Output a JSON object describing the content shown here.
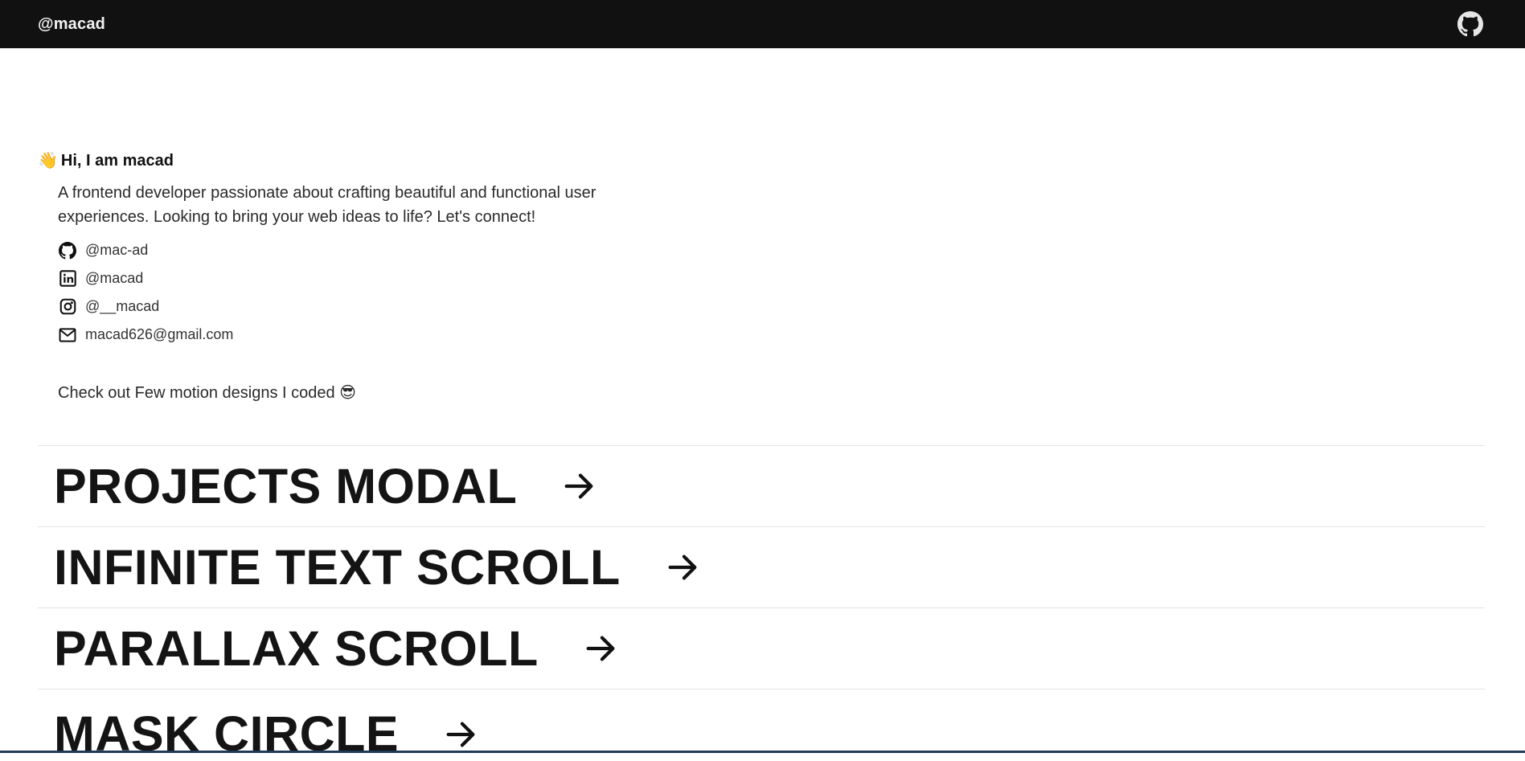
{
  "header": {
    "brand": "@macad",
    "github_icon": "github-icon"
  },
  "intro": {
    "wave_emoji": "👋",
    "greeting": "Hi, I am macad",
    "bio": "A frontend developer passionate about crafting beautiful and functional user experiences. Looking to bring your web ideas to life? Let's connect!"
  },
  "socials": [
    {
      "icon": "github-icon",
      "label": "@mac-ad"
    },
    {
      "icon": "linkedin-icon",
      "label": "@macad"
    },
    {
      "icon": "instagram-icon",
      "label": "@__macad"
    },
    {
      "icon": "mail-icon",
      "label": "macad626@gmail.com"
    }
  ],
  "motion": {
    "intro": "Check out Few motion designs I coded 😎"
  },
  "projects": [
    {
      "title": "PROJECTS MODAL",
      "icon": "arrow-right-icon"
    },
    {
      "title": "INFINITE TEXT SCROLL",
      "icon": "arrow-right-icon"
    },
    {
      "title": "PARALLAX SCROLL",
      "icon": "arrow-right-icon"
    },
    {
      "title": "MASK CIRCLE",
      "icon": "arrow-right-icon"
    }
  ],
  "colors": {
    "topbar": "#111111",
    "text": "#111111",
    "divider": "#e4e4e4"
  }
}
